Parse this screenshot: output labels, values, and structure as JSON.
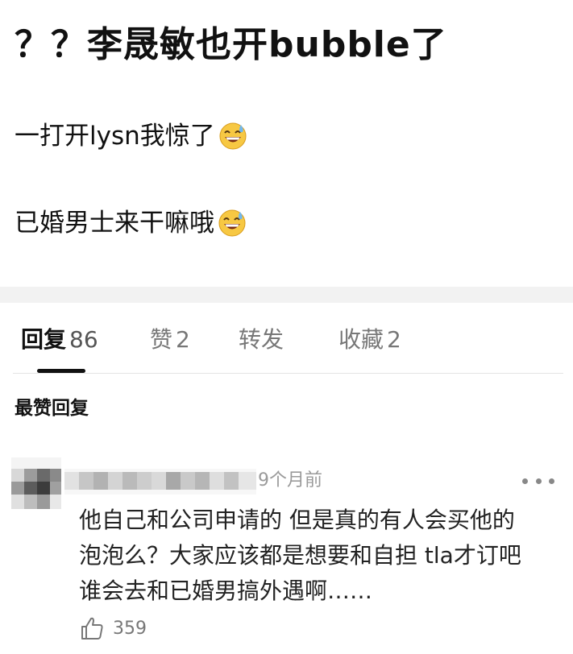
{
  "post": {
    "title": "？？李晟敏也开bubble了",
    "lines": [
      {
        "text": "一打开lysn我惊了",
        "emoji": "grinning-sweat-emoji"
      },
      {
        "text": "已婚男士来干嘛哦",
        "emoji": "grinning-sweat-emoji"
      }
    ]
  },
  "tabs": [
    {
      "label": "回复",
      "count": "86",
      "active": true
    },
    {
      "label": "赞",
      "count": "2",
      "active": false
    },
    {
      "label": "转发",
      "count": "",
      "active": false
    },
    {
      "label": "收藏",
      "count": "2",
      "active": false
    }
  ],
  "section_title": "最赞回复",
  "comment": {
    "timestamp": "9个月前",
    "lines": [
      "他自己和公司申请的  但是真的有人会买他的",
      "泡泡么？大家应该都是想要和自担 tla才订吧",
      "谁会去和已婚男搞外遇啊……"
    ],
    "likes": "359",
    "icons": {
      "more": "more-dots-icon",
      "like": "thumbs-up-icon"
    }
  }
}
